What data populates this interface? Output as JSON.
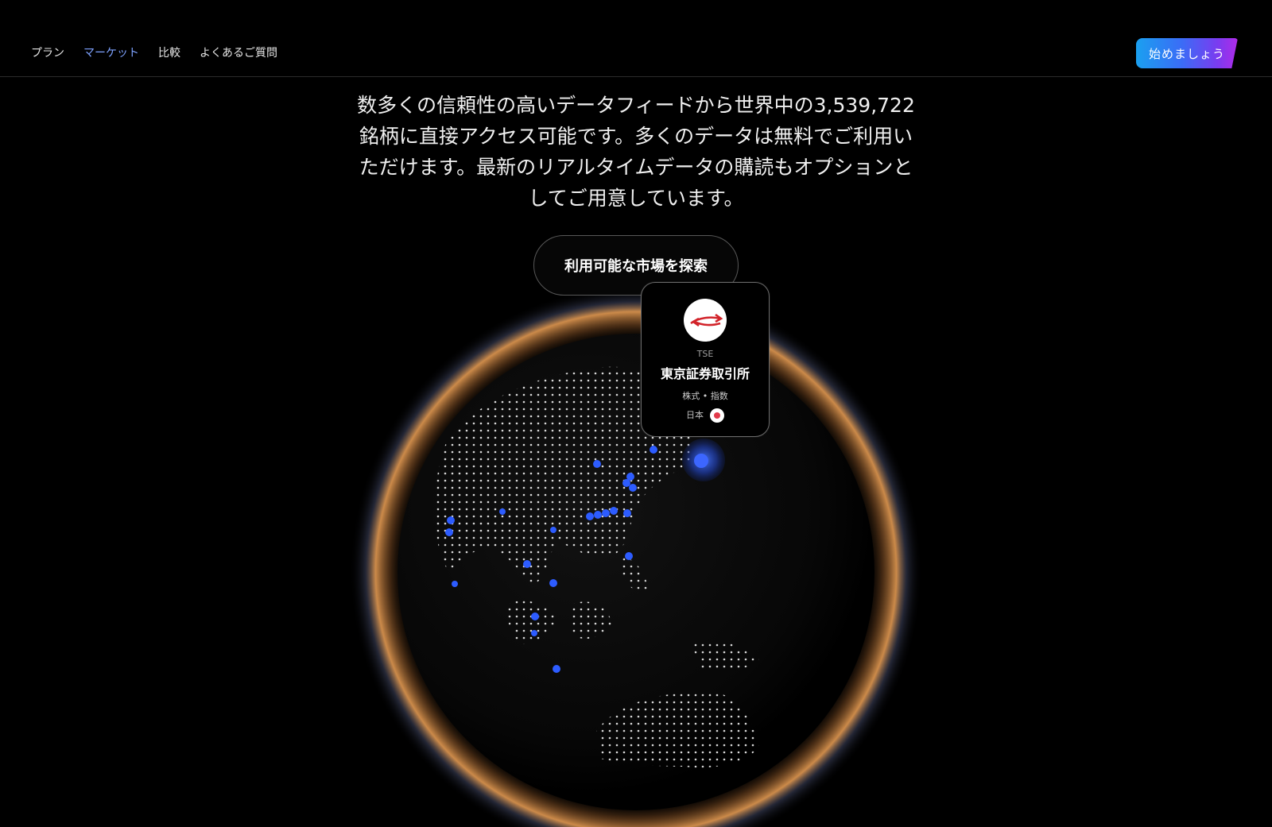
{
  "nav": {
    "items": [
      {
        "label": "プラン",
        "active": false
      },
      {
        "label": "マーケット",
        "active": true
      },
      {
        "label": "比較",
        "active": false
      },
      {
        "label": "よくあるご質問",
        "active": false
      }
    ],
    "cta_label": "始めましょう"
  },
  "hero": {
    "description_lines": [
      "数多くの信頼性の高いデータフィードから世界中の3,539,722",
      "銘柄に直接アクセス可能です。多くのデータは無料でご利用い",
      "ただけます。最新のリアルタイムデータの購読もオプションと",
      "してご用意しています。"
    ],
    "explore_label": "利用可能な市場を探索"
  },
  "exchange_card": {
    "code": "TSE",
    "name": "東京証券取引所",
    "types": "株式 • 指数",
    "country": "日本",
    "logo_icon": "tse-logo-icon",
    "flag_icon": "japan-flag-icon"
  },
  "colors": {
    "accent_nav": "#7ea2ff",
    "marker_blue": "#2d5cff",
    "cta_gradient": [
      "#1aa0f0",
      "#3b6cf6",
      "#b02be8"
    ],
    "globe_glow": "#d98a3c"
  }
}
